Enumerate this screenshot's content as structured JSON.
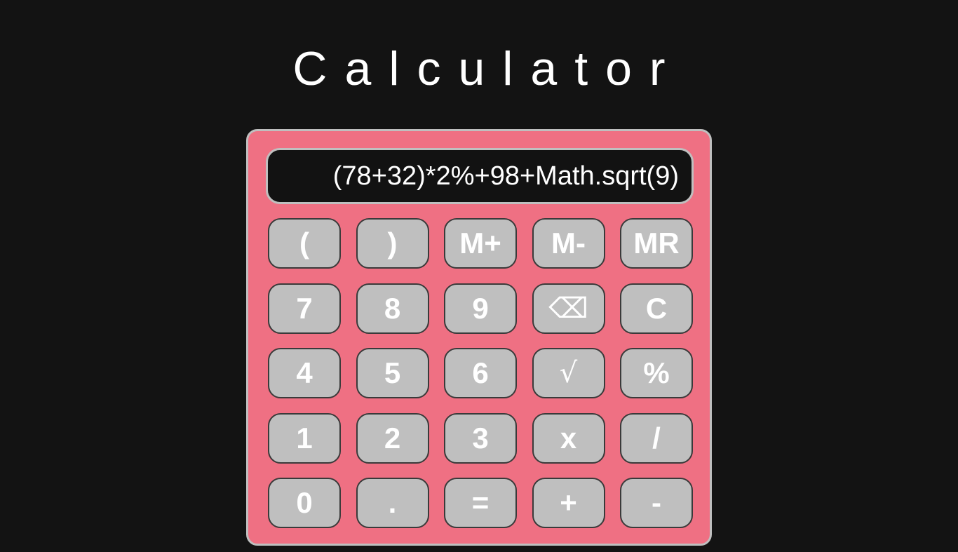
{
  "app": {
    "title": "Calculator"
  },
  "display": {
    "expression": "(78+32)*2%+98+Math.sqrt(9)"
  },
  "keys": [
    {
      "id": "open-paren",
      "label": "("
    },
    {
      "id": "close-paren",
      "label": ")"
    },
    {
      "id": "memory-add",
      "label": "M+"
    },
    {
      "id": "memory-subtract",
      "label": "M-"
    },
    {
      "id": "memory-recall",
      "label": "MR"
    },
    {
      "id": "digit-7",
      "label": "7"
    },
    {
      "id": "digit-8",
      "label": "8"
    },
    {
      "id": "digit-9",
      "label": "9"
    },
    {
      "id": "backspace",
      "label": "⌫",
      "icon": "backspace-icon"
    },
    {
      "id": "clear",
      "label": "C"
    },
    {
      "id": "digit-4",
      "label": "4"
    },
    {
      "id": "digit-5",
      "label": "5"
    },
    {
      "id": "digit-6",
      "label": "6"
    },
    {
      "id": "square-root",
      "label": "√",
      "icon": "square-root-icon"
    },
    {
      "id": "percent",
      "label": "%"
    },
    {
      "id": "digit-1",
      "label": "1"
    },
    {
      "id": "digit-2",
      "label": "2"
    },
    {
      "id": "digit-3",
      "label": "3"
    },
    {
      "id": "multiply",
      "label": "x"
    },
    {
      "id": "divide",
      "label": "/"
    },
    {
      "id": "digit-0",
      "label": "0"
    },
    {
      "id": "decimal-point",
      "label": "."
    },
    {
      "id": "equals",
      "label": "="
    },
    {
      "id": "plus",
      "label": "+"
    },
    {
      "id": "minus",
      "label": "-"
    }
  ],
  "colors": {
    "page_background": "#131313",
    "calculator_body": "#ef7083",
    "key_background": "#bfbfbf",
    "display_background": "#121212",
    "text": "#ffffff"
  }
}
